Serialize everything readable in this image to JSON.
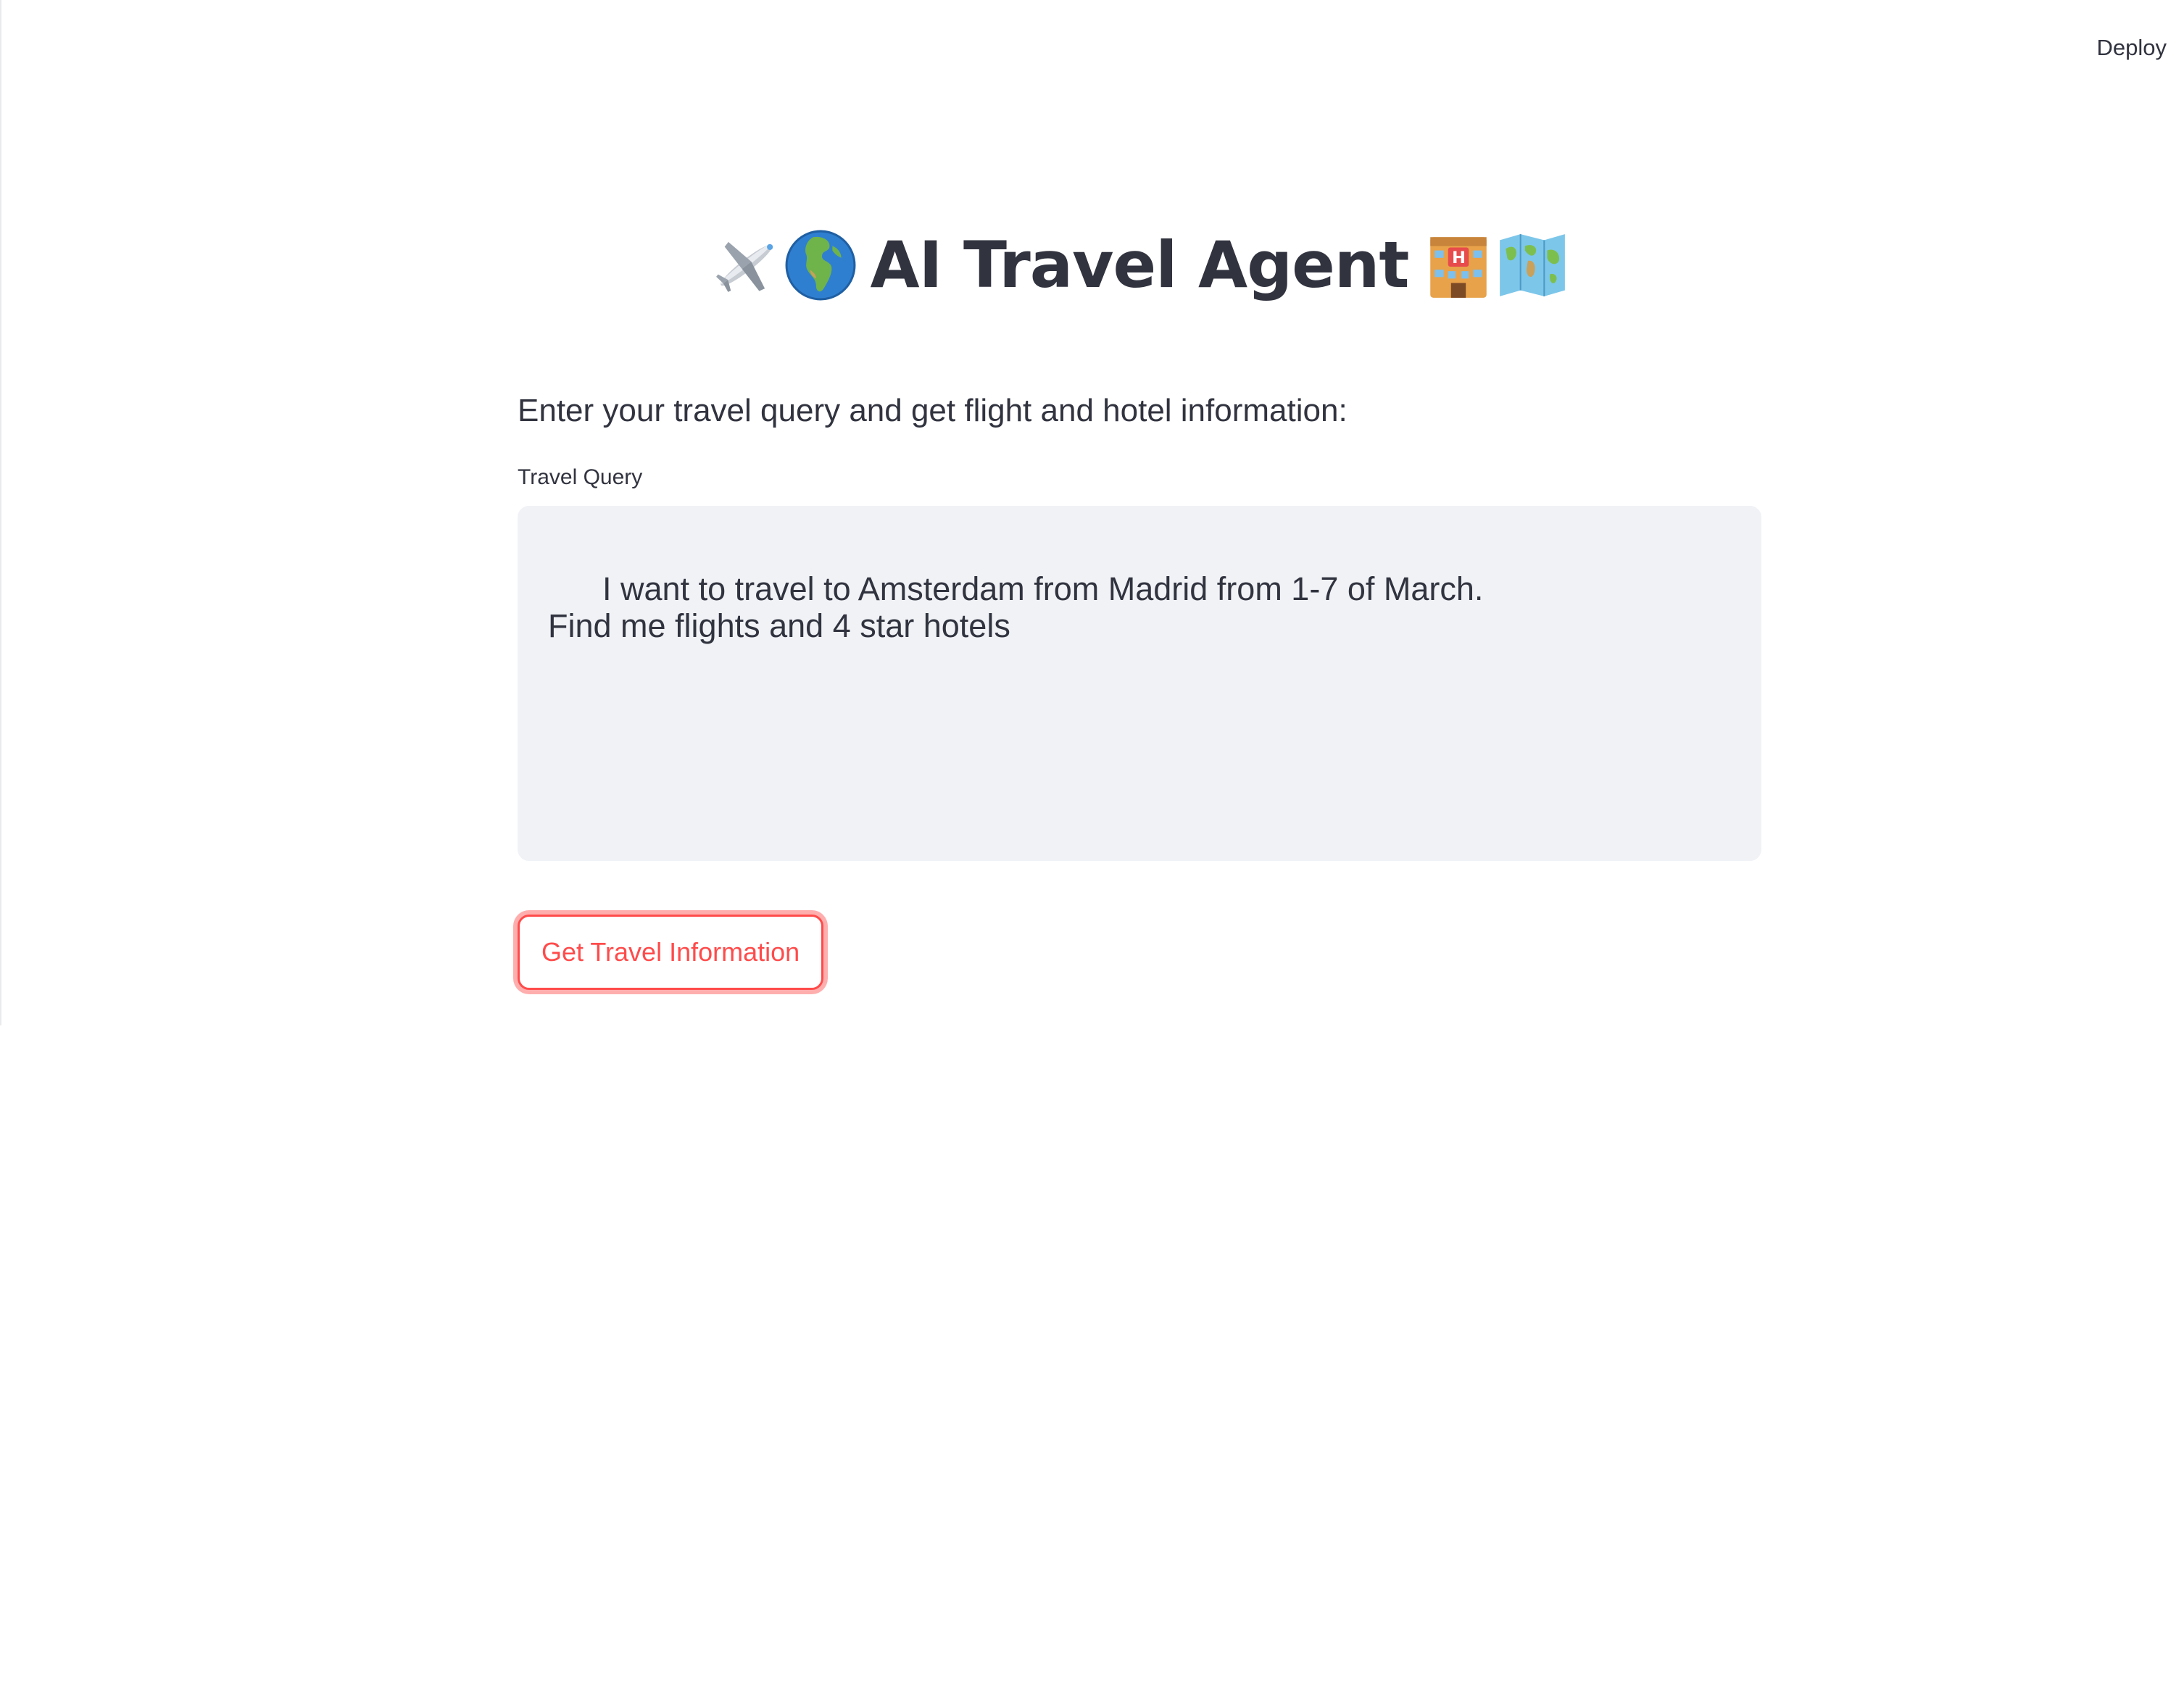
{
  "header": {
    "deploy_label": "Deploy"
  },
  "main": {
    "title": "AI Travel Agent",
    "title_icons_left": [
      "airplane-icon",
      "globe-europe-africa-icon"
    ],
    "title_icons_right": [
      "hotel-icon",
      "world-map-icon"
    ],
    "subtitle": "Enter your travel query and get flight and hotel information:",
    "query_label": "Travel Query",
    "query_value": "I want to travel to Amsterdam from Madrid from 1-7 of March.\nFind me flights and 4 star hotels",
    "submit_label": "Get Travel Information"
  },
  "colors": {
    "primary": "#ff4b4b",
    "text": "#31333f",
    "input_background": "#f0f2f6",
    "background": "#ffffff"
  }
}
